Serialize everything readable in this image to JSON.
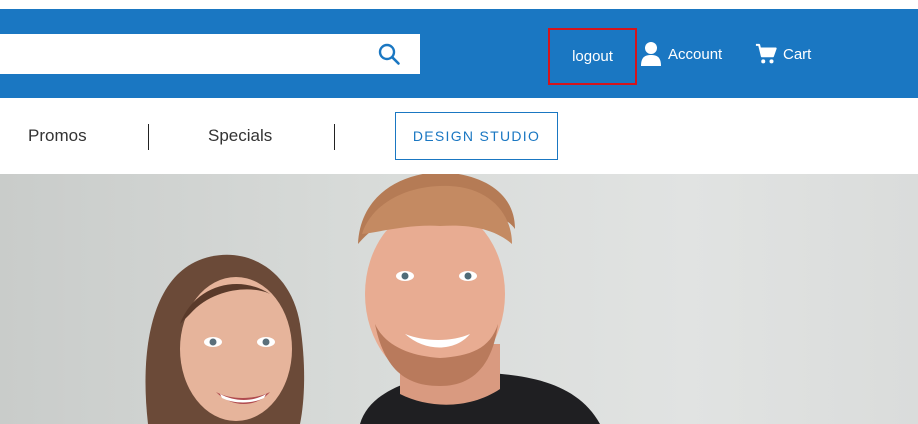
{
  "header": {
    "search": {
      "placeholder": "",
      "value": "",
      "icon": "search-icon"
    },
    "logout_label": "logout",
    "account": {
      "label": "Account",
      "icon": "user-icon"
    },
    "cart": {
      "label": "Cart",
      "icon": "cart-icon"
    }
  },
  "nav": {
    "items": [
      {
        "label": "Promos"
      },
      {
        "label": "Specials"
      }
    ],
    "design_studio_label": "DESIGN STUDIO"
  },
  "hero": {
    "image": "photo-smiling-couple"
  },
  "colors": {
    "brand_blue": "#1a77c2",
    "highlight_red": "#d4141c"
  }
}
